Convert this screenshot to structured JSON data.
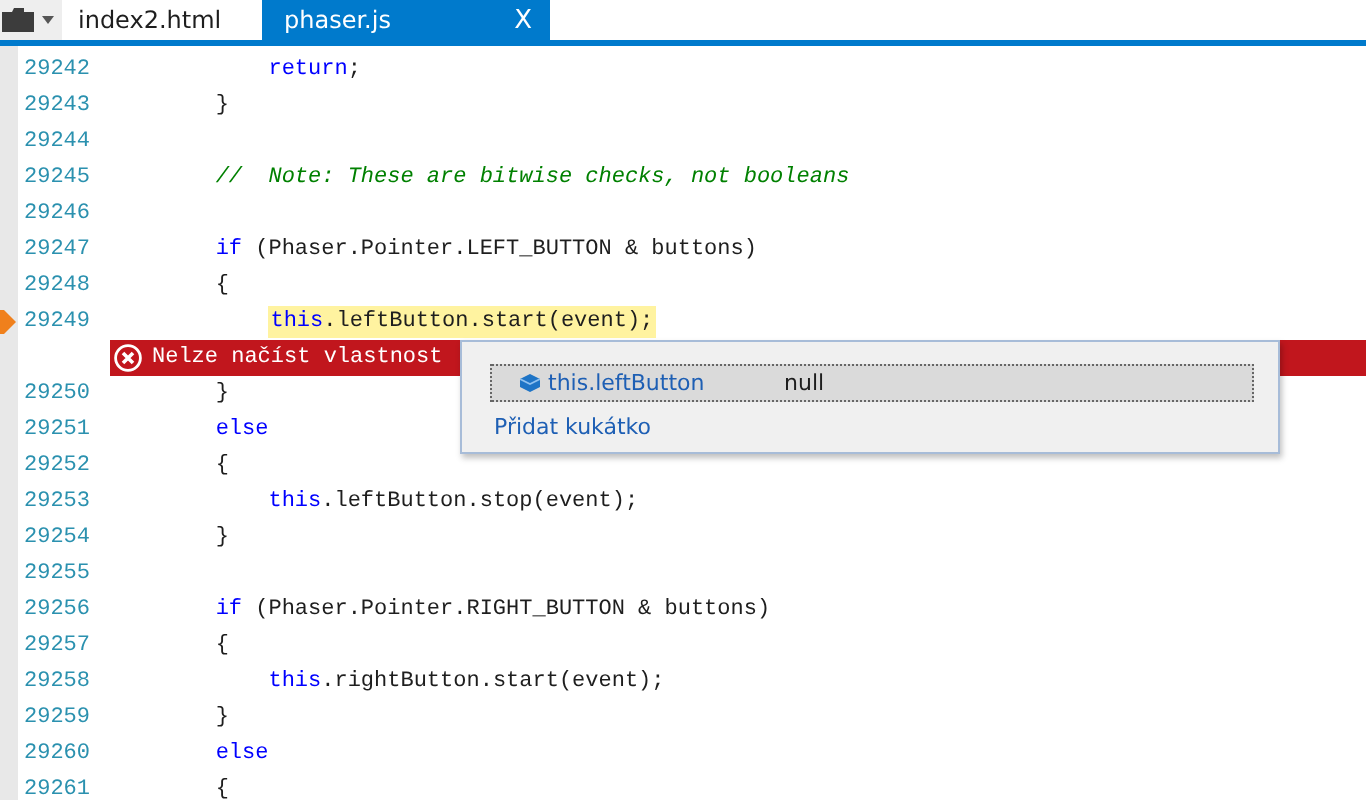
{
  "tabs": [
    {
      "label": "index2.html",
      "selected": false,
      "closable": false
    },
    {
      "label": "phaser.js",
      "selected": true,
      "closable": true
    }
  ],
  "close_glyph": "X",
  "rows": [
    {
      "kind": "fragment",
      "children": [
        {
          "kind": "code",
          "number": "29242",
          "current": false,
          "tokens": [
            {
              "kind": "keyword",
              "text": "return"
            },
            {
              "kind": "plain",
              "text": ";"
            }
          ]
        }
      ]
    },
    {
      "kind": "code",
      "number": "29243",
      "current": false,
      "tokens": [
        {
          "kind": "plain",
          "text": "}"
        }
      ]
    },
    {
      "kind": "code",
      "number": "29244",
      "tokens": []
    },
    {
      "kind": "code",
      "number": "29245",
      "current": false,
      "tokens": [
        {
          "kind": "comment",
          "text": "//  Note: These are bitwise checks, not booleans"
        }
      ]
    },
    {
      "kind": "code",
      "number": "29246",
      "tokens": []
    },
    {
      "kind": "code",
      "number": "29247",
      "current": false,
      "tokens": [
        {
          "kind": "keyword",
          "text": "if"
        },
        {
          "kind": "plain",
          "text": " (Phaser.Pointer.LEFT_BUTTON & buttons)"
        }
      ]
    },
    {
      "kind": "code",
      "number": "29248",
      "current": false,
      "tokens": [
        {
          "kind": "plain",
          "text": "{"
        }
      ],
      "children": [
        {
          "kind": "code",
          "number": "29249",
          "current": true,
          "tokens": [
            {
              "kind": "keyword",
              "text": "this"
            },
            {
              "kind": "plain",
              "text": ".leftButton.start(event);"
            }
          ]
        }
      ]
    },
    {
      "kind": "error",
      "message": "Nelze načíst vlastnost"
    },
    {
      "kind": "code",
      "number": "29250",
      "current": false,
      "tokens": [
        {
          "kind": "plain",
          "text": "}"
        }
      ]
    },
    {
      "kind": "code",
      "number": "29251",
      "current": false,
      "tokens": [
        {
          "kind": "keyword",
          "text": "else"
        }
      ]
    },
    {
      "kind": "code",
      "number": "29252",
      "current": false,
      "tokens": [
        {
          "kind": "plain",
          "text": "{"
        }
      ],
      "children": [
        {
          "kind": "code",
          "number": "29253",
          "current": false,
          "tokens": [
            {
              "kind": "keyword",
              "text": "this"
            },
            {
              "kind": "plain",
              "text": ".leftButton.stop(event);"
            }
          ]
        }
      ]
    },
    {
      "kind": "code",
      "number": "29254",
      "current": false,
      "tokens": [
        {
          "kind": "plain",
          "text": "}"
        }
      ]
    },
    {
      "kind": "code",
      "number": "29255",
      "tokens": []
    },
    {
      "kind": "code",
      "number": "29256",
      "current": false,
      "tokens": [
        {
          "kind": "keyword",
          "text": "if"
        },
        {
          "kind": "plain",
          "text": " (Phaser.Pointer.RIGHT_BUTTON & buttons)"
        }
      ]
    },
    {
      "kind": "code",
      "number": "29257",
      "current": false,
      "tokens": [
        {
          "kind": "plain",
          "text": "{"
        }
      ],
      "children": [
        {
          "kind": "code",
          "number": "29258",
          "current": false,
          "tokens": [
            {
              "kind": "keyword",
              "text": "this"
            },
            {
              "kind": "plain",
              "text": ".rightButton.start(event);"
            }
          ]
        }
      ]
    },
    {
      "kind": "code",
      "number": "29259",
      "current": false,
      "tokens": [
        {
          "kind": "plain",
          "text": "}"
        }
      ]
    },
    {
      "kind": "code",
      "number": "29260",
      "current": false,
      "tokens": [
        {
          "kind": "keyword",
          "text": "else"
        }
      ]
    },
    {
      "kind": "code",
      "number": "29261",
      "current": false,
      "tokens": [
        {
          "kind": "plain",
          "text": "{"
        }
      ]
    }
  ],
  "datatip": {
    "name": "this.leftButton",
    "value": "null",
    "action": "Přidat kukátko"
  }
}
